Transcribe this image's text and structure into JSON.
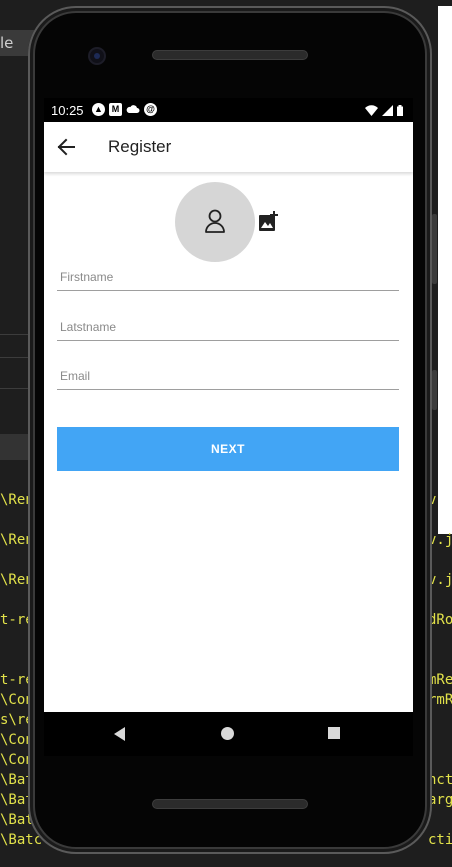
{
  "ide": {
    "tab_label": "le",
    "terminal_left": [
      "\\Ren",
      "\\Ren",
      "\\Ren",
      "t-re",
      "t-re",
      "\\Con",
      "s\\re",
      "\\Con",
      "\\Con",
      "\\Bat",
      "\\Bat",
      "\\Bat",
      "\\Batc"
    ],
    "terminal_right": [
      "v",
      "v.j",
      "v.j",
      "dRo",
      "mRe",
      "rmR",
      "nct",
      "arg",
      "ctio"
    ]
  },
  "statusbar": {
    "time": "10:25",
    "left_icons": [
      "a-icon",
      "m-icon",
      "cloud-icon",
      "sync-icon"
    ],
    "right_icons": [
      "wifi-icon",
      "signal-icon",
      "battery-icon"
    ]
  },
  "appbar": {
    "title": "Register"
  },
  "form": {
    "firstname_placeholder": "Firstname",
    "lastname_placeholder": "Latstname",
    "email_placeholder": "Email",
    "next_label": "NEXT"
  },
  "colors": {
    "accent": "#42a5f5",
    "avatar_bg": "#d6d6d6"
  }
}
